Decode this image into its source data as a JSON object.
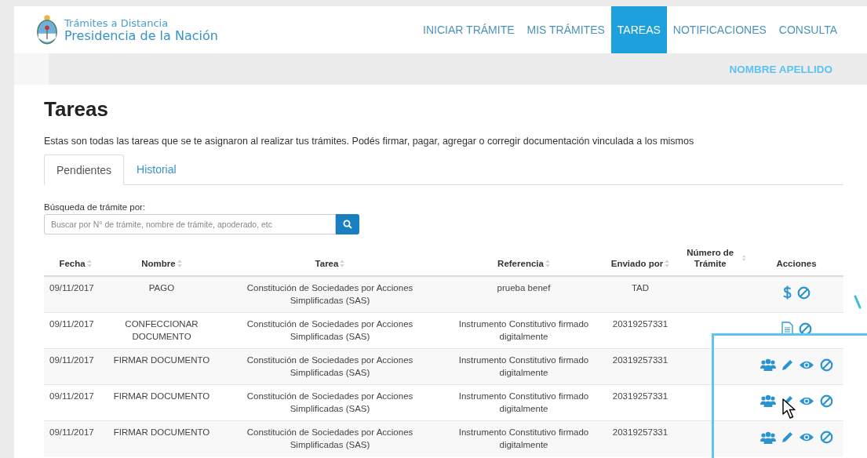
{
  "header": {
    "brand_line_1": "Trámites a Distancia",
    "brand_line_2": "Presidencia de la Nación",
    "nav": [
      {
        "label": "INICIAR TRÁMITE",
        "selected": false
      },
      {
        "label": "MIS TRÁMITES",
        "selected": false
      },
      {
        "label": "TAREAS",
        "selected": true
      },
      {
        "label": "NOTIFICACIONES",
        "selected": false
      },
      {
        "label": "CONSULTA",
        "selected": false
      }
    ],
    "user": "NOMBRE APELLIDO"
  },
  "page": {
    "title": "Tareas",
    "description": "Estas son todas las tareas que se te asignaron al realizar tus trámites. Podés firmar, pagar, agregar o corregir documentación vinculada a los mismos",
    "tabs": [
      {
        "label": "Pendientes",
        "selected": true
      },
      {
        "label": "Historial",
        "selected": false
      }
    ],
    "search": {
      "label": "Búsqueda de trámite por:",
      "placeholder": "Buscar por N° de trámite, nombre de trámite, apoderado, etc"
    }
  },
  "table": {
    "columns": [
      {
        "label": "Fecha",
        "sortable": true
      },
      {
        "label": "Nombre",
        "sortable": true
      },
      {
        "label": "Tarea",
        "sortable": true
      },
      {
        "label": "Referencia",
        "sortable": true
      },
      {
        "label": "Enviado por",
        "sortable": true
      },
      {
        "label": "Número de Trámite",
        "sortable": true
      },
      {
        "label": "Acciones",
        "sortable": false
      }
    ],
    "rows": [
      {
        "fecha": "09/11/2017",
        "nombre": "PAGO",
        "tarea": "Constitución de Sociedades por Acciones Simplificadas (SAS)",
        "referencia": "prueba benef",
        "enviado_por": "TAD",
        "actions": [
          {
            "kind": "pay"
          },
          {
            "kind": "cancel"
          }
        ]
      },
      {
        "fecha": "09/11/2017",
        "nombre": "CONFECCIONAR DOCUMENTO",
        "tarea": "Constitución de Sociedades por Acciones Simplificadas (SAS)",
        "referencia": "Instrumento Constitutivo firmado digitalmente",
        "enviado_por": "20319257331",
        "actions": [
          {
            "kind": "document"
          },
          {
            "kind": "cancel"
          }
        ]
      },
      {
        "fecha": "09/11/2017",
        "nombre": "FIRMAR DOCUMENTO",
        "tarea": "Constitución de Sociedades por Acciones Simplificadas (SAS)",
        "referencia": "Instrumento Constitutivo firmado digitalmente",
        "enviado_por": "20319257331",
        "actions": [
          {
            "kind": "group"
          },
          {
            "kind": "edit"
          },
          {
            "kind": "view"
          },
          {
            "kind": "cancel"
          }
        ]
      },
      {
        "fecha": "09/11/2017",
        "nombre": "FIRMAR DOCUMENTO",
        "tarea": "Constitución de Sociedades por Acciones Simplificadas (SAS)",
        "referencia": "Instrumento Constitutivo firmado digitalmente",
        "enviado_por": "20319257331",
        "actions": [
          {
            "kind": "group"
          },
          {
            "kind": "edit"
          },
          {
            "kind": "view"
          },
          {
            "kind": "cancel"
          }
        ]
      },
      {
        "fecha": "09/11/2017",
        "nombre": "FIRMAR DOCUMENTO",
        "tarea": "Constitución de Sociedades por Acciones Simplificadas (SAS)",
        "referencia": "Instrumento Constitutivo firmado digitalmente",
        "enviado_por": "20319257331",
        "actions": [
          {
            "kind": "group"
          },
          {
            "kind": "edit"
          },
          {
            "kind": "view"
          },
          {
            "kind": "cancel"
          }
        ]
      }
    ]
  }
}
